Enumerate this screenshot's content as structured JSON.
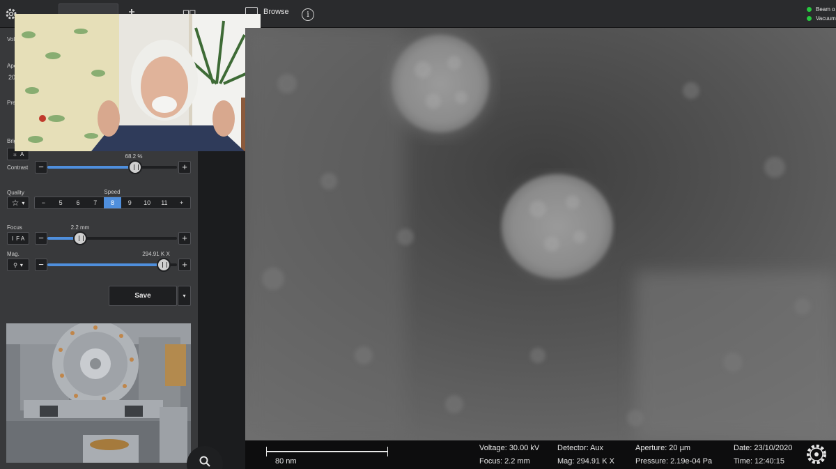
{
  "toolbar": {
    "browse_label": "Browse",
    "info_label": "i",
    "status": [
      {
        "label": "Beam o",
        "color": "#27c93f"
      },
      {
        "label": "Vacuum",
        "color": "#27c93f"
      }
    ]
  },
  "panel": {
    "voltage_label": "Volt",
    "aperture_label": "Ape",
    "aperture_value": "20",
    "preset_label": "Pre",
    "brightness_label": "Brig",
    "brightness_auto": "A",
    "contrast_label": "Contrast",
    "contrast_value_text": "68.2 %",
    "contrast_fraction": 0.68,
    "quality_label": "Quality",
    "speed_label": "Speed",
    "speed_options": [
      "5",
      "6",
      "7",
      "8",
      "9",
      "10",
      "11"
    ],
    "speed_selected": "8",
    "focus_label": "Focus",
    "focus_button": "F A",
    "focus_value_text": "2.2 mm",
    "focus_fraction": 0.25,
    "mag_label": "Mag.",
    "mag_value_text": "294.91 K X",
    "mag_fraction": 0.9,
    "minus": "−",
    "plus": "+",
    "save_label": "Save"
  },
  "sem_info": {
    "scale_label": "80 nm",
    "voltage": "Voltage: 30.00 kV",
    "focus": "Focus: 2.2 mm",
    "detector": "Detector: Aux",
    "mag": "Mag: 294.91 K X",
    "aperture": "Aperture: 20 µm",
    "pressure": "Pressure: 2.19e-04 Pa",
    "date": "Date: 23/10/2020",
    "time": "Time: 12:40:15"
  },
  "colors": {
    "accent": "#4f8fdd",
    "status_ok": "#27c93f",
    "panel_bg": "#38393b"
  }
}
